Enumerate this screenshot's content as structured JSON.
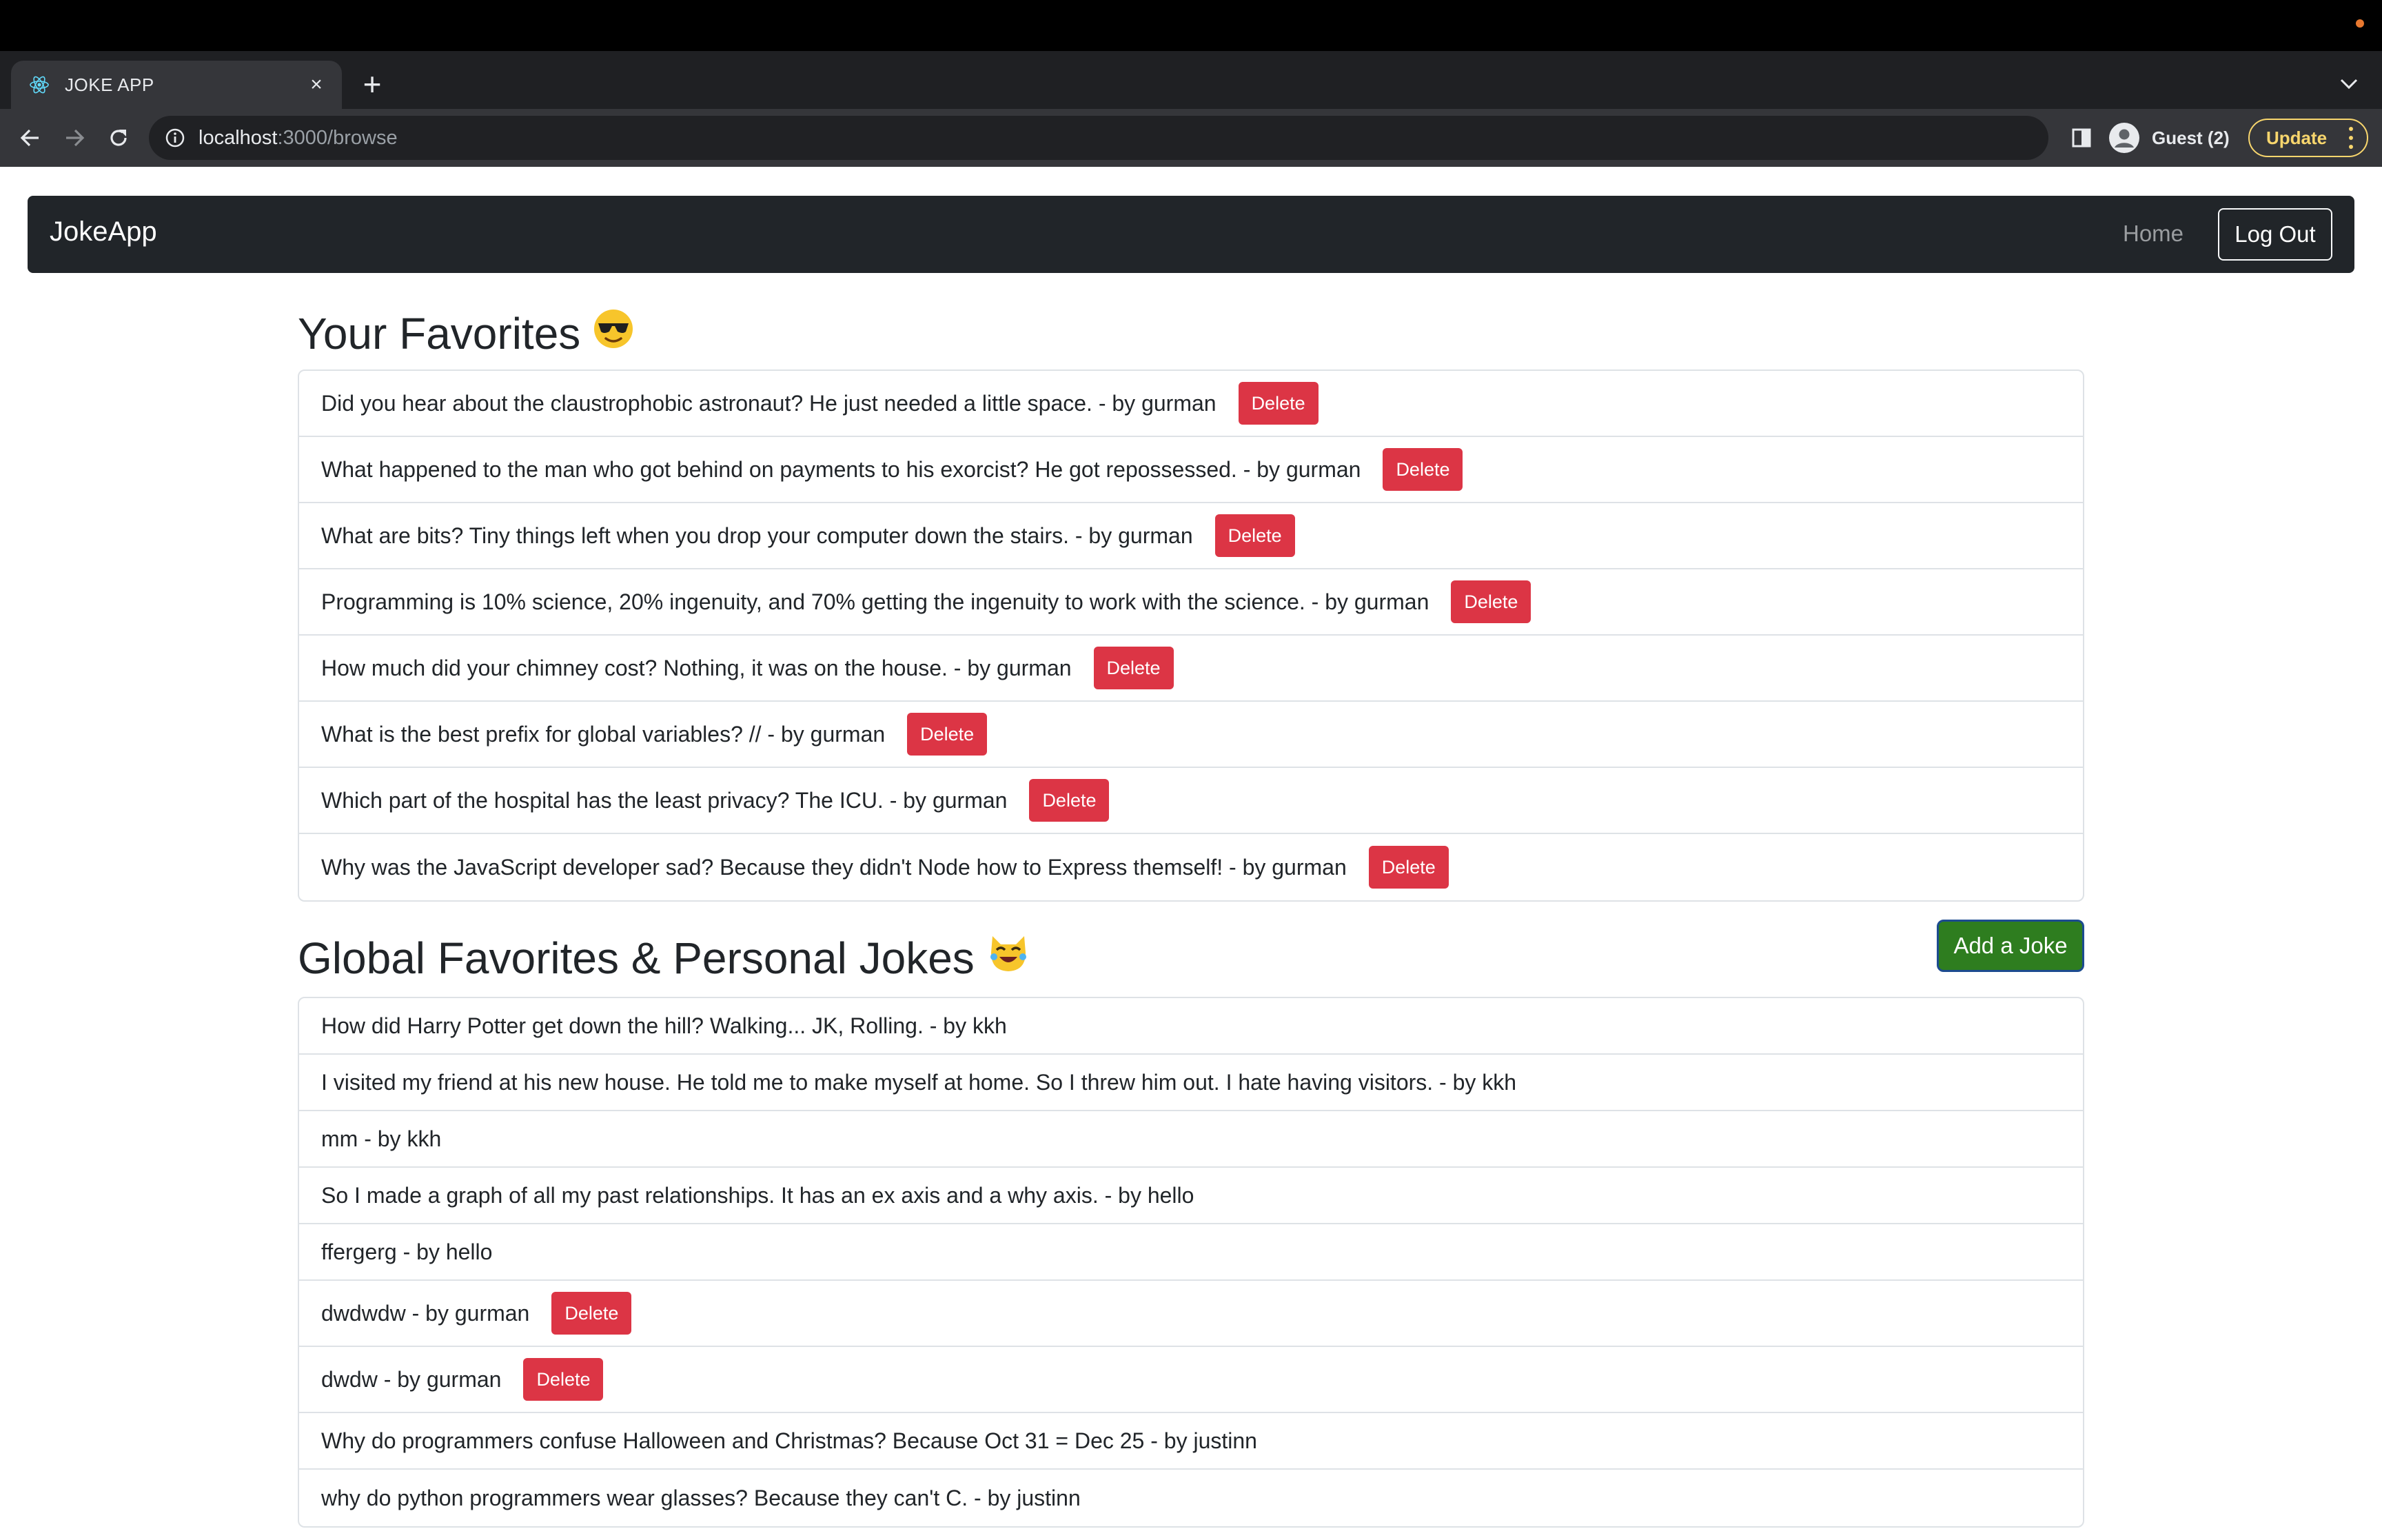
{
  "browser": {
    "tab": {
      "title": "JOKE APP",
      "close_icon": "×"
    },
    "new_tab_icon": "+",
    "url": {
      "host": "localhost",
      "path": ":3000/browse"
    },
    "profile": {
      "label": "Guest (2)"
    },
    "update": {
      "label": "Update"
    }
  },
  "navbar": {
    "brand": "JokeApp",
    "home": "Home",
    "logout": "Log Out"
  },
  "favorites": {
    "title": "Your Favorites",
    "emoji": "😎",
    "items": [
      {
        "text": "Did you hear about the claustrophobic astronaut? He just needed a little space. - by gurman",
        "button": "Delete"
      },
      {
        "text": "What happened to the man who got behind on payments to his exorcist? He got repossessed. - by gurman",
        "button": "Delete"
      },
      {
        "text": "What are bits? Tiny things left when you drop your computer down the stairs. - by gurman",
        "button": "Delete"
      },
      {
        "text": "Programming is 10% science, 20% ingenuity, and 70% getting the ingenuity to work with the science. - by gurman",
        "button": "Delete"
      },
      {
        "text": "How much did your chimney cost? Nothing, it was on the house. - by gurman",
        "button": "Delete"
      },
      {
        "text": "What is the best prefix for global variables? // - by gurman",
        "button": "Delete"
      },
      {
        "text": "Which part of the hospital has the least privacy? The ICU. - by gurman",
        "button": "Delete"
      },
      {
        "text": "Why was the JavaScript developer sad? Because they didn't Node how to Express themself! - by gurman",
        "button": "Delete"
      }
    ]
  },
  "global": {
    "title": "Global Favorites & Personal Jokes",
    "emoji": "😹",
    "add_button": "Add a Joke",
    "items": [
      {
        "text": "How did Harry Potter get down the hill? Walking... JK, Rolling. - by kkh",
        "button": ""
      },
      {
        "text": "I visited my friend at his new house. He told me to make myself at home. So I threw him out. I hate having visitors. - by kkh",
        "button": ""
      },
      {
        "text": "mm - by kkh",
        "button": ""
      },
      {
        "text": "So I made a graph of all my past relationships. It has an ex axis and a why axis. - by hello",
        "button": ""
      },
      {
        "text": "ffergerg - by hello",
        "button": ""
      },
      {
        "text": "dwdwdw - by gurman",
        "button": "Delete"
      },
      {
        "text": "dwdw - by gurman",
        "button": "Delete"
      },
      {
        "text": "Why do programmers confuse Halloween and Christmas? Because Oct 31 = Dec 25 - by justinn",
        "button": ""
      },
      {
        "text": "why do python programmers wear glasses? Because they can't C. - by justinn",
        "button": ""
      }
    ]
  }
}
